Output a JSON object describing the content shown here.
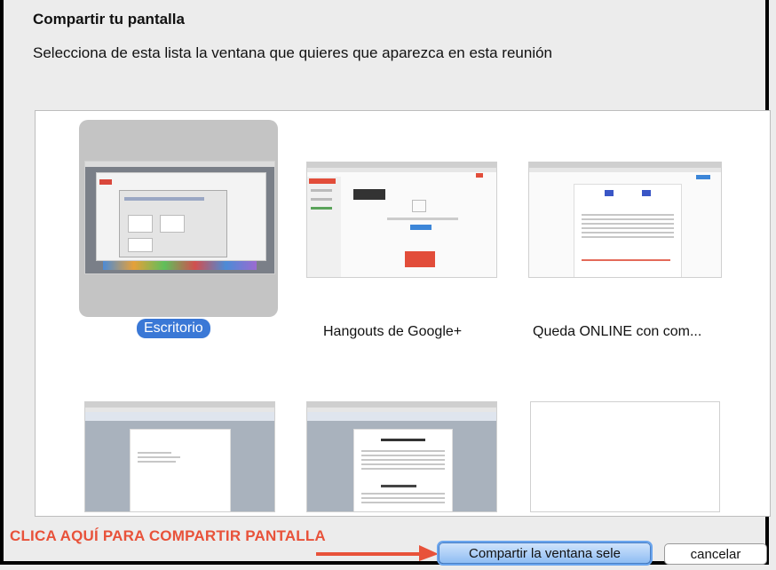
{
  "dialog": {
    "title": "Compartir tu pantalla",
    "subtitle": "Selecciona de esta lista la ventana que quieres que aparezca en esta reunión"
  },
  "windows": [
    {
      "label": "Escritorio",
      "selected": true
    },
    {
      "label": "Hangouts de Google+",
      "selected": false
    },
    {
      "label": "Queda ONLINE con com...",
      "selected": false
    },
    {
      "label": "",
      "selected": false
    },
    {
      "label": "",
      "selected": false
    },
    {
      "label": "",
      "selected": false
    }
  ],
  "annotation": {
    "text": "CLICA AQUÍ PARA COMPARTIR PANTALLA",
    "color": "#e8523a"
  },
  "buttons": {
    "share": "Compartir la ventana sele",
    "cancel": "cancelar"
  },
  "colors": {
    "selection": "#3a78d6",
    "selected_tile": "#c4c4c4"
  }
}
